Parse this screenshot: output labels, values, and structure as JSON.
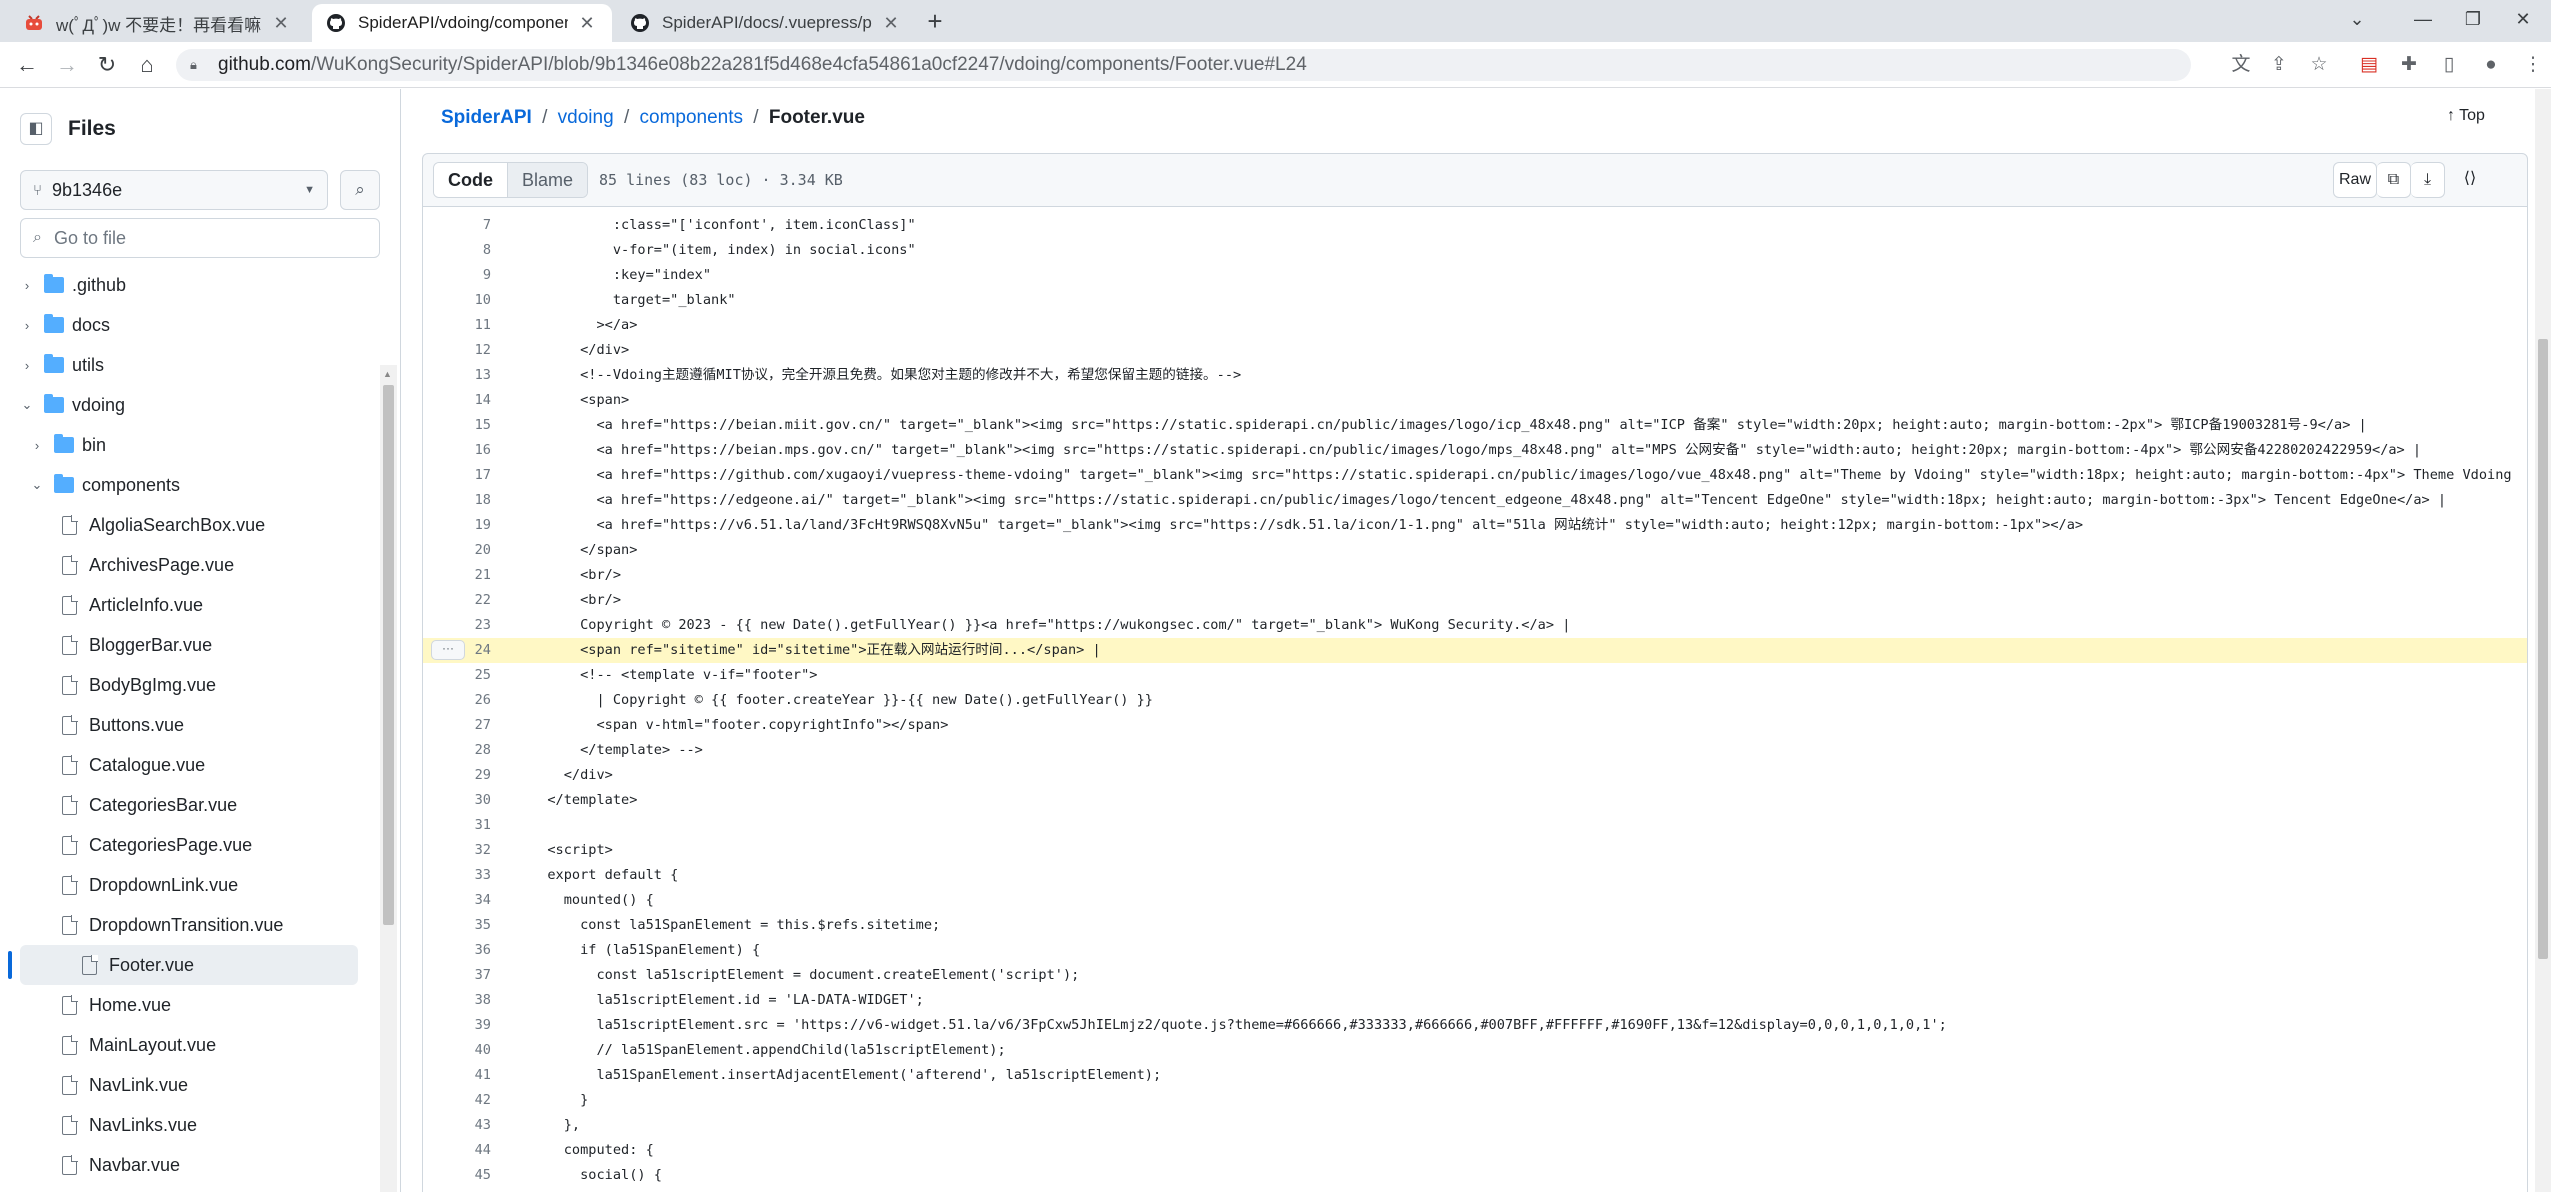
{
  "browser": {
    "tabs": [
      {
        "title": "w(ﾟДﾟ)w 不要走！再看看嘛！",
        "icon": "bilibili-icon"
      },
      {
        "title": "SpiderAPI/vdoing/components/",
        "icon": "github-icon"
      },
      {
        "title": "SpiderAPI/docs/.vuepress/publ",
        "icon": "github-icon"
      }
    ],
    "url_host": "github.com",
    "url_path": "/WuKongSecurity/SpiderAPI/blob/9b1346e08b22a281f5d468e4cfa54861a0cf2247/vdoing/components/Footer.vue#L24"
  },
  "sidebar": {
    "title": "Files",
    "branch": "9b1346e",
    "go_to_file_placeholder": "Go to file",
    "tree": [
      {
        "label": ".github",
        "type": "folder",
        "level": 0,
        "expanded": false
      },
      {
        "label": "docs",
        "type": "folder",
        "level": 0,
        "expanded": false
      },
      {
        "label": "utils",
        "type": "folder",
        "level": 0,
        "expanded": false
      },
      {
        "label": "vdoing",
        "type": "folder",
        "level": 0,
        "expanded": true
      },
      {
        "label": "bin",
        "type": "folder",
        "level": 1,
        "expanded": false
      },
      {
        "label": "components",
        "type": "folder",
        "level": 1,
        "expanded": true
      },
      {
        "label": "AlgoliaSearchBox.vue",
        "type": "file",
        "level": 2
      },
      {
        "label": "ArchivesPage.vue",
        "type": "file",
        "level": 2
      },
      {
        "label": "ArticleInfo.vue",
        "type": "file",
        "level": 2
      },
      {
        "label": "BloggerBar.vue",
        "type": "file",
        "level": 2
      },
      {
        "label": "BodyBgImg.vue",
        "type": "file",
        "level": 2
      },
      {
        "label": "Buttons.vue",
        "type": "file",
        "level": 2
      },
      {
        "label": "Catalogue.vue",
        "type": "file",
        "level": 2
      },
      {
        "label": "CategoriesBar.vue",
        "type": "file",
        "level": 2
      },
      {
        "label": "CategoriesPage.vue",
        "type": "file",
        "level": 2
      },
      {
        "label": "DropdownLink.vue",
        "type": "file",
        "level": 2
      },
      {
        "label": "DropdownTransition.vue",
        "type": "file",
        "level": 2
      },
      {
        "label": "Footer.vue",
        "type": "file",
        "level": 2,
        "selected": true
      },
      {
        "label": "Home.vue",
        "type": "file",
        "level": 2
      },
      {
        "label": "MainLayout.vue",
        "type": "file",
        "level": 2
      },
      {
        "label": "NavLink.vue",
        "type": "file",
        "level": 2
      },
      {
        "label": "NavLinks.vue",
        "type": "file",
        "level": 2
      },
      {
        "label": "Navbar.vue",
        "type": "file",
        "level": 2
      }
    ]
  },
  "breadcrumb": {
    "repo": "SpiderAPI",
    "dir1": "vdoing",
    "dir2": "components",
    "file": "Footer.vue",
    "sep": "/"
  },
  "top_label": "Top",
  "filebar": {
    "code_tab": "Code",
    "blame_tab": "Blame",
    "meta": "85 lines (83 loc) · 3.34 KB",
    "raw_label": "Raw"
  },
  "highlighted_line": 24,
  "code_lines": [
    {
      "n": "7",
      "text": "          :class=\"['iconfont', item.iconClass]\""
    },
    {
      "n": "8",
      "text": "          v-for=\"(item, index) in social.icons\""
    },
    {
      "n": "9",
      "text": "          :key=\"index\""
    },
    {
      "n": "10",
      "text": "          target=\"_blank\""
    },
    {
      "n": "11",
      "text": "        ></a>"
    },
    {
      "n": "12",
      "text": "      </div>"
    },
    {
      "n": "13",
      "text": "      <!--Vdoing主题遵循MIT协议，完全开源且免费。如果您对主题的修改并不大，希望您保留主题的链接。-->"
    },
    {
      "n": "14",
      "text": "      <span>"
    },
    {
      "n": "15",
      "text": "        <a href=\"https://beian.miit.gov.cn/\" target=\"_blank\"><img src=\"https://static.spiderapi.cn/public/images/logo/icp_48x48.png\" alt=\"ICP 备案\" style=\"width:20px; height:auto; margin-bottom:-2px\"> 鄂ICP备19003281号-9</a> |"
    },
    {
      "n": "16",
      "text": "        <a href=\"https://beian.mps.gov.cn/\" target=\"_blank\"><img src=\"https://static.spiderapi.cn/public/images/logo/mps_48x48.png\" alt=\"MPS 公网安备\" style=\"width:auto; height:20px; margin-bottom:-4px\"> 鄂公网安备42280202422959</a> |"
    },
    {
      "n": "17",
      "text": "        <a href=\"https://github.com/xugaoyi/vuepress-theme-vdoing\" target=\"_blank\"><img src=\"https://static.spiderapi.cn/public/images/logo/vue_48x48.png\" alt=\"Theme by Vdoing\" style=\"width:18px; height:auto; margin-bottom:-4px\"> Theme Vdoing"
    },
    {
      "n": "18",
      "text": "        <a href=\"https://edgeone.ai/\" target=\"_blank\"><img src=\"https://static.spiderapi.cn/public/images/logo/tencent_edgeone_48x48.png\" alt=\"Tencent EdgeOne\" style=\"width:18px; height:auto; margin-bottom:-3px\"> Tencent EdgeOne</a> |"
    },
    {
      "n": "19",
      "text": "        <a href=\"https://v6.51.la/land/3FcHt9RWSQ8XvN5u\" target=\"_blank\"><img src=\"https://sdk.51.la/icon/1-1.png\" alt=\"51la 网站统计\" style=\"width:auto; height:12px; margin-bottom:-1px\"></a>"
    },
    {
      "n": "20",
      "text": "      </span>"
    },
    {
      "n": "21",
      "text": "      <br/>"
    },
    {
      "n": "22",
      "text": "      <br/>"
    },
    {
      "n": "23",
      "text": "      Copyright © 2023 - {{ new Date().getFullYear() }}<a href=\"https://wukongsec.com/\" target=\"_blank\"> WuKong Security.</a> |"
    },
    {
      "n": "24",
      "text": "      <span ref=\"sitetime\" id=\"sitetime\">正在载入网站运行时间...</span> |"
    },
    {
      "n": "25",
      "text": "      <!-- <template v-if=\"footer\">"
    },
    {
      "n": "26",
      "text": "        | Copyright © {{ footer.createYear }}-{{ new Date().getFullYear() }}"
    },
    {
      "n": "27",
      "text": "        <span v-html=\"footer.copyrightInfo\"></span>"
    },
    {
      "n": "28",
      "text": "      </template> -->"
    },
    {
      "n": "29",
      "text": "    </div>"
    },
    {
      "n": "30",
      "text": "  </template>"
    },
    {
      "n": "31",
      "text": ""
    },
    {
      "n": "32",
      "text": "  <script>"
    },
    {
      "n": "33",
      "text": "  export default {"
    },
    {
      "n": "34",
      "text": "    mounted() {"
    },
    {
      "n": "35",
      "text": "      const la51SpanElement = this.$refs.sitetime;"
    },
    {
      "n": "36",
      "text": "      if (la51SpanElement) {"
    },
    {
      "n": "37",
      "text": "        const la51scriptElement = document.createElement('script');"
    },
    {
      "n": "38",
      "text": "        la51scriptElement.id = 'LA-DATA-WIDGET';"
    },
    {
      "n": "39",
      "text": "        la51scriptElement.src = 'https://v6-widget.51.la/v6/3FpCxw5JhIELmjz2/quote.js?theme=#666666,#333333,#666666,#007BFF,#FFFFFF,#1690FF,13&f=12&display=0,0,0,1,0,1,0,1';"
    },
    {
      "n": "40",
      "text": "        // la51SpanElement.appendChild(la51scriptElement);"
    },
    {
      "n": "41",
      "text": "        la51SpanElement.insertAdjacentElement('afterend', la51scriptElement);"
    },
    {
      "n": "42",
      "text": "      }"
    },
    {
      "n": "43",
      "text": "    },"
    },
    {
      "n": "44",
      "text": "    computed: {"
    },
    {
      "n": "45",
      "text": "      social() {"
    }
  ]
}
